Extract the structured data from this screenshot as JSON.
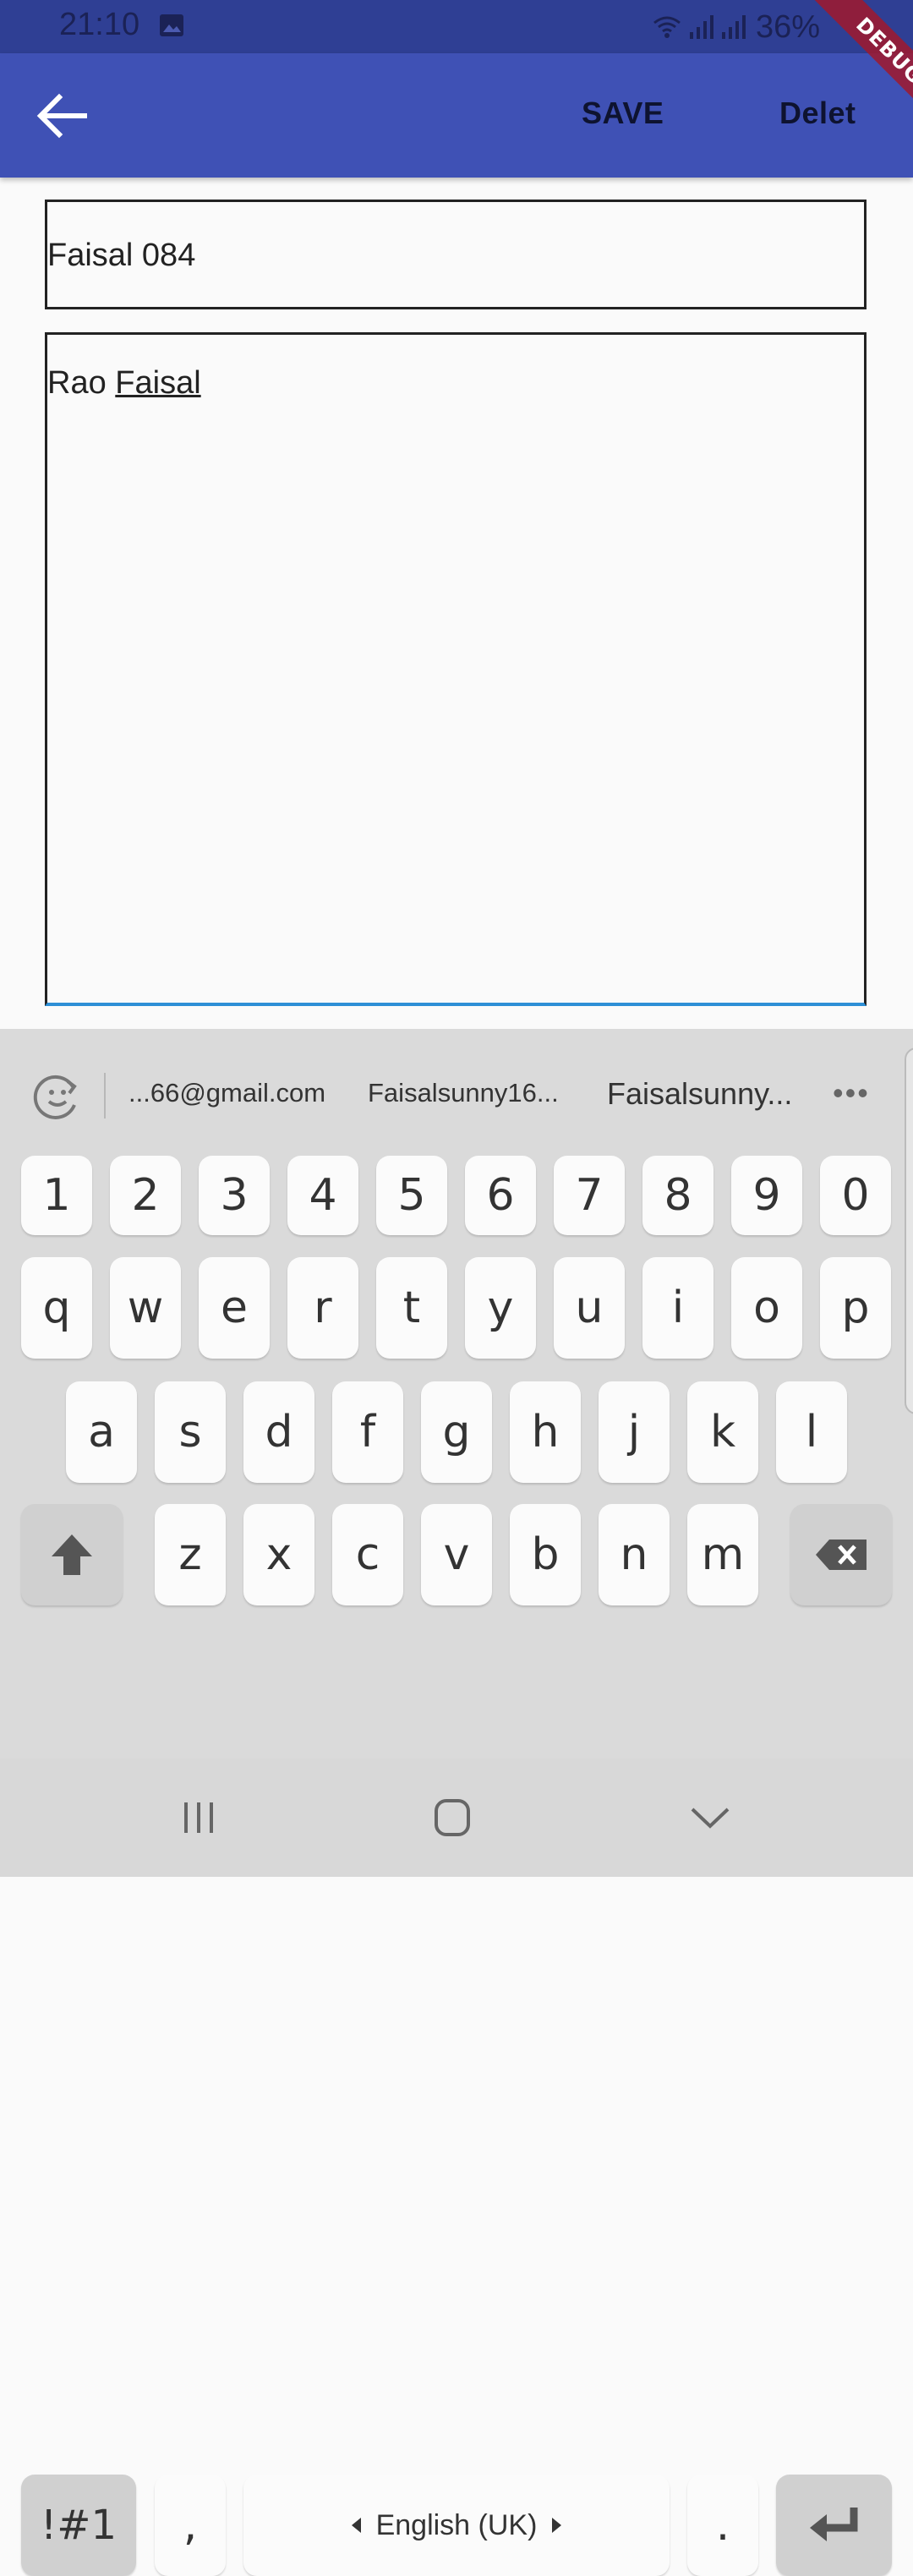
{
  "status_bar": {
    "time": "21:10",
    "battery": "36%",
    "icons": [
      "image-icon",
      "wifi-icon",
      "signal-icon",
      "signal-icon"
    ]
  },
  "app_bar": {
    "save_label": "SAVE",
    "delete_label": "Delet",
    "debug_label": "DEBUG",
    "color": "#3f51b5"
  },
  "form": {
    "title_value": "Faisal 084",
    "body_prefix": "Rao ",
    "body_underlined": "Faisal"
  },
  "keyboard": {
    "suggestions": [
      "...66@gmail.com",
      "Faisalsunny16...",
      "Faisalsunny..."
    ],
    "more": "•••",
    "row_numbers": [
      "1",
      "2",
      "3",
      "4",
      "5",
      "6",
      "7",
      "8",
      "9",
      "0"
    ],
    "row_q": [
      "q",
      "w",
      "e",
      "r",
      "t",
      "y",
      "u",
      "i",
      "o",
      "p"
    ],
    "row_a": [
      "a",
      "s",
      "d",
      "f",
      "g",
      "h",
      "j",
      "k",
      "l"
    ],
    "row_z": [
      "z",
      "x",
      "c",
      "v",
      "b",
      "n",
      "m"
    ],
    "symbols_label": "!#1",
    "comma": ",",
    "space_label": "English (UK)",
    "period": "."
  }
}
